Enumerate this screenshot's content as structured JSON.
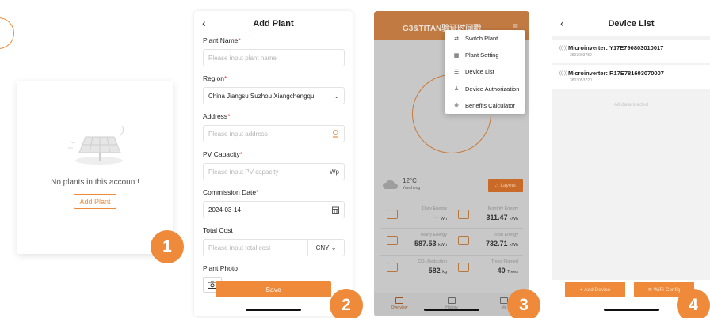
{
  "badges": [
    "1",
    "2",
    "3",
    "4"
  ],
  "panel1": {
    "empty_message": "No plants in this account!",
    "add_plant_button": "Add Plant"
  },
  "panel2": {
    "title": "Add Plant",
    "fields": {
      "plant_name": {
        "label": "Plant Name",
        "placeholder": "Please input plant name"
      },
      "region": {
        "label": "Region",
        "value": "China Jiangsu Suzhou Xiangchengqu"
      },
      "address": {
        "label": "Address",
        "placeholder": "Please input address"
      },
      "pv_capacity": {
        "label": "PV Capacity",
        "placeholder": "Please input PV capacity",
        "unit": "Wp"
      },
      "commission_date": {
        "label": "Commission Date",
        "value": "2024-03-14"
      },
      "total_cost": {
        "label": "Total Cost",
        "placeholder": "Please input total cost",
        "currency": "CNY"
      },
      "plant_photo": {
        "label": "Plant Photo"
      }
    },
    "save_button": "Save"
  },
  "panel3": {
    "header_title": "G3&TITAN验证时间戳",
    "menu": [
      "Switch Plant",
      "Plant Setting",
      "Device List",
      "Device Authorization",
      "Benefits Calculator"
    ],
    "weather": {
      "temp": "12°C",
      "city": "Yancheng"
    },
    "layout_button": "Layout",
    "stats": [
      {
        "label": "Daily Energy",
        "value": "--",
        "unit": "Wh"
      },
      {
        "label": "Monthly Energy",
        "value": "311.47",
        "unit": "kWh"
      },
      {
        "label": "Yearly Energy",
        "value": "587.53",
        "unit": "kWh"
      },
      {
        "label": "Total Energy",
        "value": "732.71",
        "unit": "kWh"
      },
      {
        "label": "CO₂ Reduction",
        "value": "582",
        "unit": "kg"
      },
      {
        "label": "Trees Planted",
        "value": "40",
        "unit": "Trees"
      }
    ],
    "tabs": [
      "Overview",
      "History",
      "Me"
    ]
  },
  "panel4": {
    "title": "Device List",
    "devices": [
      {
        "name": "Microinverter: Y17E790803010017",
        "sub": "3803003789"
      },
      {
        "name": "Microinverter: R17E781603070007",
        "sub": "3803053720"
      }
    ],
    "loaded_text": "All data loaded",
    "add_device_button": "Add Device",
    "wifi_config_button": "WiFi Config"
  },
  "colors": {
    "accent": "#ef8a3a",
    "header": "#c17a42"
  }
}
